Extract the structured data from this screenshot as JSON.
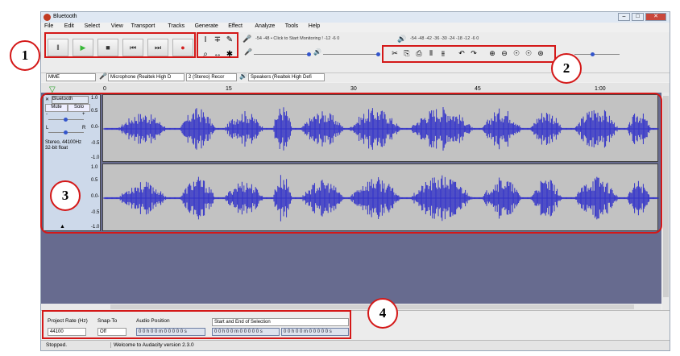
{
  "window": {
    "title": "Bluetooth"
  },
  "menu": [
    "File",
    "Edit",
    "Select",
    "View",
    "Transport",
    "Tracks",
    "Generate",
    "Effect",
    "Analyze",
    "Tools",
    "Help"
  ],
  "transport": {
    "buttons": [
      {
        "icon": "pause-icon",
        "glyph": "‖"
      },
      {
        "icon": "play-icon",
        "glyph": "▶"
      },
      {
        "icon": "stop-icon",
        "glyph": "■"
      },
      {
        "icon": "skip-start-icon",
        "glyph": "⏮"
      },
      {
        "icon": "skip-end-icon",
        "glyph": "⏭"
      },
      {
        "icon": "record-icon",
        "glyph": "●"
      }
    ]
  },
  "tools": {
    "row1": [
      "I",
      "∓",
      "✎"
    ],
    "row2": [
      "⌕",
      "↔",
      "✱"
    ]
  },
  "meters": {
    "record_scale": "-54  -48  • Click to Start Monitoring !  -12   -6   0",
    "play_scale": "-54   -48   -42   -36   -30   -24   -18   -12   -6   0"
  },
  "edit_toolbar": [
    {
      "icon": "cut-icon",
      "glyph": "✂"
    },
    {
      "icon": "copy-icon",
      "glyph": "⎘"
    },
    {
      "icon": "paste-icon",
      "glyph": "⎙"
    },
    {
      "icon": "trim-icon",
      "glyph": "⫴"
    },
    {
      "icon": "silence-icon",
      "glyph": "⫵"
    },
    {
      "icon": "undo-icon",
      "glyph": "↶"
    },
    {
      "icon": "redo-icon",
      "glyph": "↷"
    },
    {
      "icon": "zoom-in-icon",
      "glyph": "⊕"
    },
    {
      "icon": "zoom-out-icon",
      "glyph": "⊖"
    },
    {
      "icon": "fit-selection-icon",
      "glyph": "☉"
    },
    {
      "icon": "fit-project-icon",
      "glyph": "☉"
    },
    {
      "icon": "zoom-toggle-icon",
      "glyph": "⊛"
    }
  ],
  "devices": {
    "host": "MME",
    "recording": "Microphone (Realtek High D",
    "channels": "2 (Stereo) Recor",
    "playback": "Speakers (Realtek High Defi"
  },
  "timeline": {
    "ticks": [
      "0",
      "15",
      "30",
      "45",
      "1:00"
    ]
  },
  "track": {
    "name": "Bluetooth",
    "mute": "Mute",
    "solo": "Solo",
    "gain_minus": "-",
    "gain_plus": "+",
    "pan_left": "L",
    "pan_right": "R",
    "info1": "Stereo, 44100Hz",
    "info2": "32-bit float",
    "scale": [
      "1.0",
      "0.5",
      "0.0-",
      "-0.5",
      "-1.0"
    ]
  },
  "selection_toolbar": {
    "rate_label": "Project Rate (Hz)",
    "rate_value": "44100",
    "snap_label": "Snap-To",
    "snap_value": "Off",
    "position_label": "Audio Position",
    "position_value": "0 0 h 0 0 m 0 0 0 0 0 s",
    "selection_mode": "Start and End of Selection",
    "start_value": "0 0 h 0 0 m 0 0 0 0 0 s",
    "end_value": "0 0 h 0 0 m 0 0 0 0 0 s"
  },
  "status": {
    "left": "Stopped.",
    "right": "Welcome to Audacity version 2.3.0"
  },
  "callouts": [
    "1",
    "2",
    "3",
    "4"
  ],
  "colors": {
    "waveform": "#3232c8",
    "annotation": "#d41818",
    "track_bg": "#676b8f"
  }
}
